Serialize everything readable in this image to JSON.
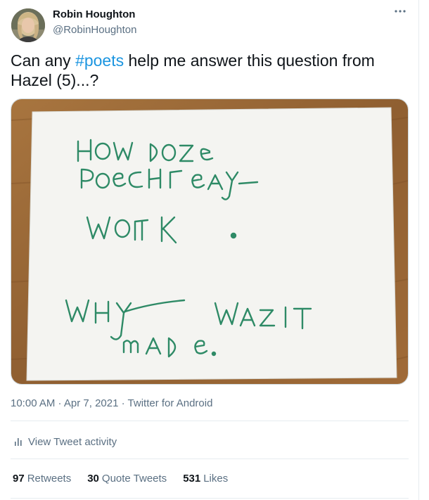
{
  "author": {
    "name": "Robin Houghton",
    "handle": "@RobinHoughton"
  },
  "more_icon": "more-horizontal-icon",
  "tweet": {
    "text_before": "Can any ",
    "hashtag": "#poets",
    "text_after": " help me answer this question from Hazel (5)...?"
  },
  "photo": {
    "handwritten_lines": [
      "HOW DOZE",
      "POeCHreAY",
      "WOrK .",
      "WHY WAzIT",
      "MADe."
    ],
    "ink_color": "#2e8a66",
    "paper_color": "#f4f4f1",
    "table_color": "#9a6a3a"
  },
  "meta": {
    "time": "10:00 AM",
    "separator1": " · ",
    "date": "Apr 7, 2021",
    "separator2": " · ",
    "source": "Twitter for Android"
  },
  "activity": {
    "icon": "bar-chart-icon",
    "label": "View Tweet activity"
  },
  "stats": {
    "retweets_count": "97",
    "retweets_label": "Retweets",
    "quotes_count": "30",
    "quotes_label": "Quote Tweets",
    "likes_count": "531",
    "likes_label": "Likes"
  },
  "colors": {
    "link": "#1b95e0",
    "secondary_text": "#5b7083",
    "divider": "#e6ecf0"
  }
}
